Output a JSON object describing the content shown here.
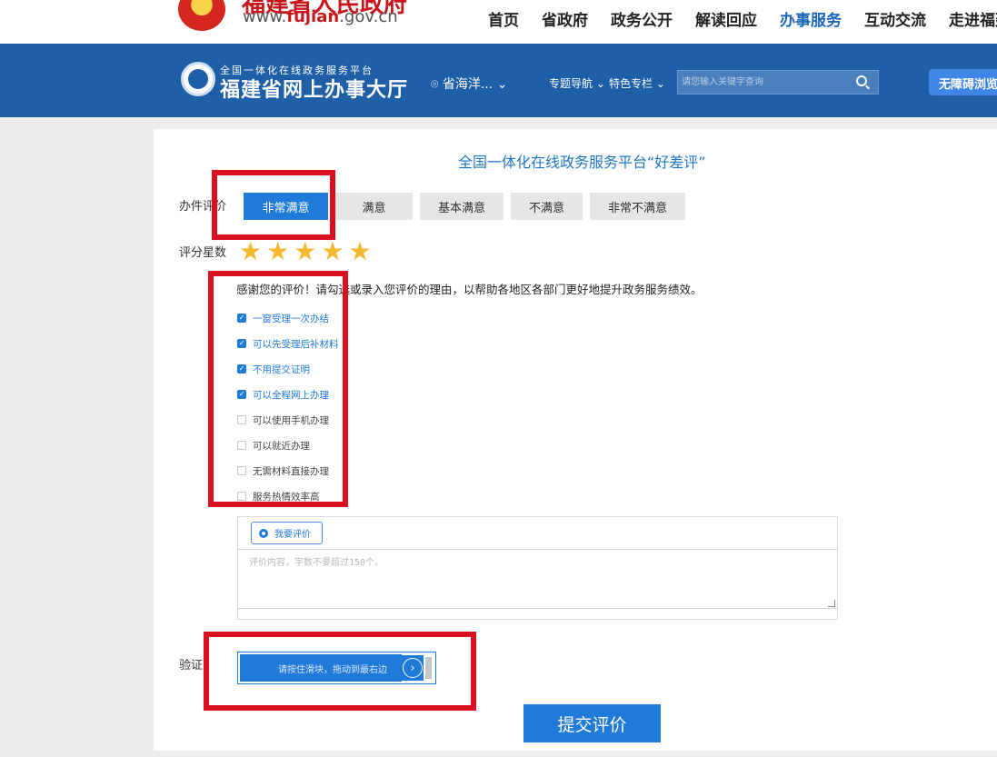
{
  "header": {
    "site_name": "福建省人民政府",
    "url_prefix": "www.",
    "url_highlight": "fujian",
    "url_suffix": ".gov.cn",
    "nav": [
      "首页",
      "省政府",
      "政务公开",
      "解读回应",
      "办事服务",
      "互动交流",
      "走进福建"
    ],
    "active_nav": "办事服务"
  },
  "service_bar": {
    "logo_sub": "全国一体化在线政务服务平台",
    "logo_main": "福建省网上办事大厅",
    "location": "省海洋...",
    "topic_nav": "专题导航",
    "special_column": "特色专栏",
    "search_placeholder": "请您输入关键字查询",
    "accessibility": "无障碍浏览"
  },
  "review": {
    "title": "全国一体化在线政务服务平台“好差评”",
    "rating_label": "办件评价",
    "rating_options": [
      "非常满意",
      "满意",
      "基本满意",
      "不满意",
      "非常不满意"
    ],
    "selected_rating": "非常满意",
    "stars_label": "评分星数",
    "stars": 5,
    "thanks_text": "感谢您的评价！请勾选或录入您评价的理由，以帮助各地区各部门更好地提升政务服务绩效。",
    "reasons": [
      {
        "label": "一窗受理一次办结",
        "checked": true
      },
      {
        "label": "可以先受理后补材料",
        "checked": true
      },
      {
        "label": "不用提交证明",
        "checked": true
      },
      {
        "label": "可以全程网上办理",
        "checked": true
      },
      {
        "label": "可以使用手机办理",
        "checked": false
      },
      {
        "label": "可以就近办理",
        "checked": false
      },
      {
        "label": "无需材料直接办理",
        "checked": false
      },
      {
        "label": "服务热情效率高",
        "checked": false
      }
    ],
    "comment_tab": "我要评价",
    "comment_placeholder": "评价内容，字数不要超过150个。",
    "verify_label": "验证",
    "slider_text": "请按住滑块，拖动到最右边",
    "submit": "提交评价"
  },
  "colors": {
    "brand_blue": "#1f5fa8",
    "accent": "#1f7ad9",
    "highlight_red": "#d8101f",
    "star": "#f5b82e"
  }
}
